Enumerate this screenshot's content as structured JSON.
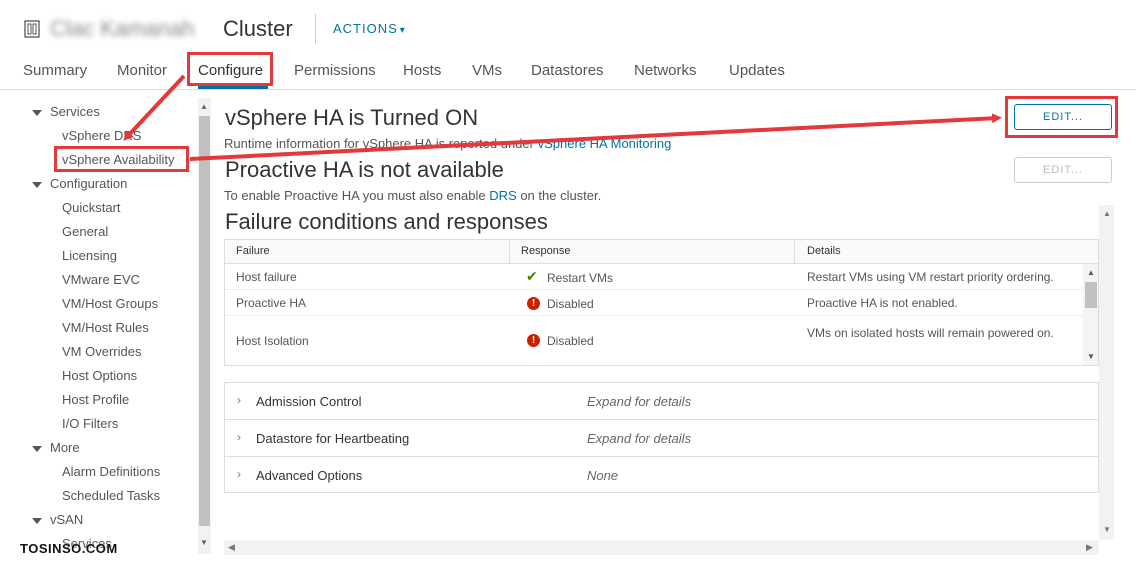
{
  "header": {
    "cluster_name_obscured": "Clac Kamanah",
    "title": "Cluster",
    "actions_label": "ACTIONS"
  },
  "tabs": [
    {
      "label": "Summary"
    },
    {
      "label": "Monitor"
    },
    {
      "label": "Configure"
    },
    {
      "label": "Permissions"
    },
    {
      "label": "Hosts"
    },
    {
      "label": "VMs"
    },
    {
      "label": "Datastores"
    },
    {
      "label": "Networks"
    },
    {
      "label": "Updates"
    }
  ],
  "sidebar": {
    "services_group": "Services",
    "services_items": [
      "vSphere DRS",
      "vSphere Availability"
    ],
    "configuration_group": "Configuration",
    "configuration_items": [
      "Quickstart",
      "General",
      "Licensing",
      "VMware EVC",
      "VM/Host Groups",
      "VM/Host Rules",
      "VM Overrides",
      "Host Options",
      "Host Profile",
      "I/O Filters"
    ],
    "more_group": "More",
    "more_items": [
      "Alarm Definitions",
      "Scheduled Tasks"
    ],
    "vsan_group": "vSAN",
    "vsan_items": [
      "Services"
    ]
  },
  "main": {
    "ha_title": "vSphere HA is Turned ON",
    "ha_info_prefix": "Runtime information for vSphere HA is reported under",
    "ha_info_link": "vSphere HA Monitoring",
    "edit_label": "EDIT...",
    "proactive_title": "Proactive HA is not available",
    "proactive_info_prefix": "To enable Proactive HA you must also enable",
    "proactive_info_link": "DRS",
    "proactive_info_suffix": "on the cluster.",
    "proactive_edit_label": "EDIT...",
    "failure_title": "Failure conditions and responses"
  },
  "failure_table": {
    "columns": [
      "Failure",
      "Response",
      "Details"
    ],
    "rows": [
      {
        "failure": "Host failure",
        "response": "Restart VMs",
        "status": "ok",
        "details": "Restart VMs using VM restart priority ordering."
      },
      {
        "failure": "Proactive HA",
        "response": "Disabled",
        "status": "error",
        "details": "Proactive HA is not enabled."
      },
      {
        "failure": "Host Isolation",
        "response": "Disabled",
        "status": "error",
        "details": "VMs on isolated hosts will remain powered on."
      }
    ]
  },
  "accordion": [
    {
      "label": "Admission Control",
      "value": "Expand for details"
    },
    {
      "label": "Datastore for Heartbeating",
      "value": "Expand for details"
    },
    {
      "label": "Advanced Options",
      "value": "None"
    }
  ],
  "watermark": "TOSINSO.COM",
  "colors": {
    "accent": "#0072a3",
    "annotation": "#e3393c",
    "ok": "#3c8500",
    "error": "#c92100"
  }
}
